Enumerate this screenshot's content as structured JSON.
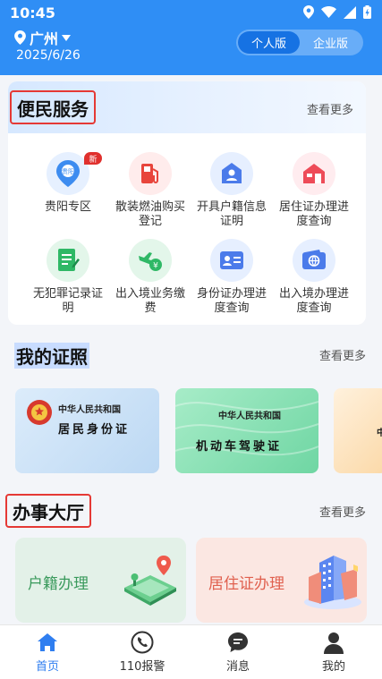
{
  "status_bar": {
    "time": "10:45"
  },
  "header": {
    "city": "广州",
    "date": "2025/6/26",
    "segments": [
      "个人版",
      "企业版"
    ],
    "active_segment": "个人版"
  },
  "services": {
    "title": "便民服务",
    "more": "查看更多",
    "items": [
      {
        "label": "贵阳专区",
        "icon": "guiyang-zone-icon",
        "badge": "新"
      },
      {
        "label": "散装燃油购买登记",
        "icon": "fuel-pump-icon"
      },
      {
        "label": "开具户籍信息证明",
        "icon": "household-cert-icon"
      },
      {
        "label": "居住证办理进度查询",
        "icon": "residence-home-icon"
      },
      {
        "label": "无犯罪记录证明",
        "icon": "no-crime-cert-icon"
      },
      {
        "label": "出入境业务缴费",
        "icon": "airplane-pay-icon"
      },
      {
        "label": "身份证办理进度查询",
        "icon": "id-card-icon"
      },
      {
        "label": "出入境办理进度查询",
        "icon": "passport-globe-icon"
      }
    ]
  },
  "licences": {
    "title": "我的证照",
    "more": "查看更多",
    "cards": [
      {
        "country": "中华人民共和国",
        "name": "居民身份证"
      },
      {
        "country": "中华人民共和国",
        "name": "机动车驾驶证"
      },
      {
        "country": "中"
      }
    ]
  },
  "hall": {
    "title": "办事大厅",
    "more": "查看更多",
    "cards": [
      {
        "label": "户籍办理"
      },
      {
        "label": "居住证办理"
      }
    ]
  },
  "tabbar": {
    "tabs": [
      {
        "label": "首页",
        "icon": "home-icon"
      },
      {
        "label": "110报警",
        "icon": "phone-icon"
      },
      {
        "label": "消息",
        "icon": "message-icon"
      },
      {
        "label": "我的",
        "icon": "person-icon"
      }
    ],
    "active": "首页"
  },
  "colors": {
    "brand": "#2f8ef5",
    "highlight_box": "#e53935",
    "tab_active": "#2f7ef0"
  }
}
